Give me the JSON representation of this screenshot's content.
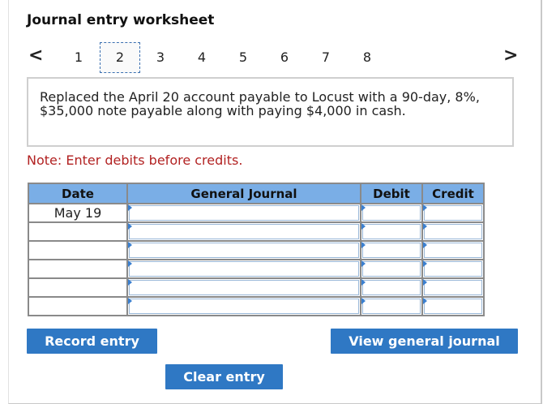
{
  "title": "Journal entry worksheet",
  "nav": {
    "prev": "<",
    "next": ">",
    "pages": [
      "1",
      "2",
      "3",
      "4",
      "5",
      "6",
      "7",
      "8"
    ],
    "active": "2"
  },
  "scenario": "Replaced the April 20 account payable to Locust with a 90-day, 8%, $35,000 note payable along with paying $4,000 in cash.",
  "note": "Note: Enter debits before credits.",
  "table": {
    "headers": [
      "Date",
      "General Journal",
      "Debit",
      "Credit"
    ],
    "rows": [
      {
        "date": "May 19"
      },
      {
        "date": ""
      },
      {
        "date": ""
      },
      {
        "date": ""
      },
      {
        "date": ""
      },
      {
        "date": ""
      }
    ]
  },
  "buttons": {
    "record": "Record entry",
    "clear": "Clear entry",
    "view": "View general journal"
  }
}
